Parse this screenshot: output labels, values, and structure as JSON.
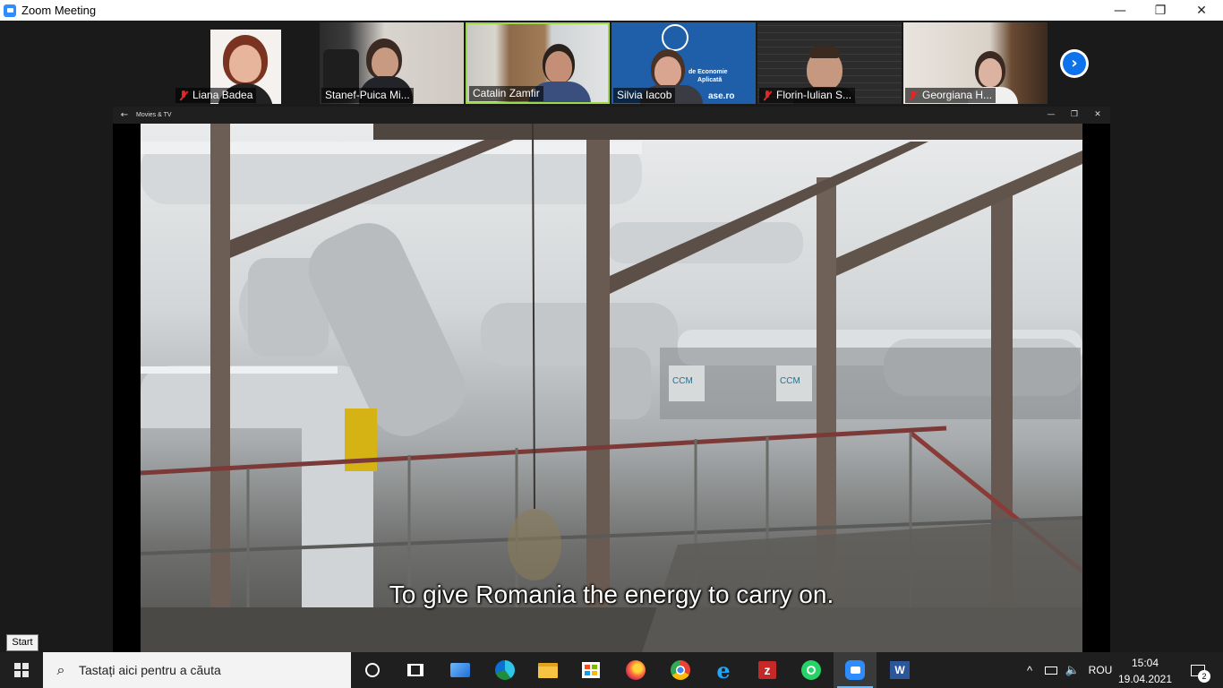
{
  "window": {
    "title": "Zoom Meeting",
    "controls": {
      "minimize": "—",
      "restore": "❐",
      "close": "✕"
    }
  },
  "participants": [
    {
      "name": "Liana Badea",
      "muted": true
    },
    {
      "name": "Stanef-Puica Mi...",
      "muted": false
    },
    {
      "name": "Catalin Zamfir",
      "muted": false,
      "active_speaker": true
    },
    {
      "name": "Silvia Iacob",
      "muted": false,
      "background_text": [
        "de Economie",
        "Aplicată",
        "ase.ro"
      ]
    },
    {
      "name": "Florin-Iulian S...",
      "muted": true
    },
    {
      "name": "Georgiana H...",
      "muted": true
    }
  ],
  "gallery_next_icon": "chevron-right-icon",
  "shared_app": {
    "title": "Movies & TV",
    "back_icon": "←",
    "controls": {
      "minimize": "—",
      "restore": "❐",
      "close": "✕"
    },
    "video_labels": [
      "CCM",
      "CCM"
    ],
    "subtitle": "To give Romania the energy to carry on."
  },
  "start_tooltip": "Start",
  "taskbar": {
    "search_placeholder": "Tastați aici pentru a căuta",
    "apps": [
      "cortana-icon",
      "task-view-icon",
      "network-app-icon",
      "edge-icon",
      "file-explorer-icon",
      "store-icon",
      "firefox-icon",
      "chrome-icon",
      "internet-explorer-icon",
      "winzip-icon",
      "whatsapp-icon",
      "zoom-icon",
      "word-icon"
    ],
    "tray": {
      "chevron": "^",
      "language": "ROU",
      "notifications_count": "2"
    },
    "clock": {
      "time": "15:04",
      "date": "19.04.2021"
    }
  },
  "colors": {
    "accent": "#0e72ed",
    "zoom_blue": "#2d8cff",
    "muted_red": "#e02828",
    "taskbar": "#1f1f1f"
  }
}
